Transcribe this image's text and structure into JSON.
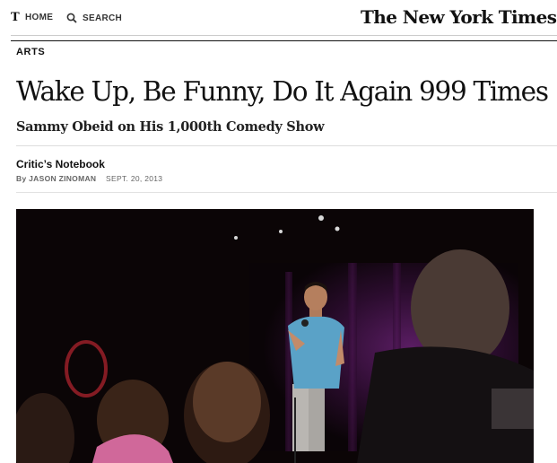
{
  "nav": {
    "home_label": "HOME",
    "search_label": "SEARCH",
    "t_logo": "T"
  },
  "masthead": "The New York Times",
  "section": "ARTS",
  "article": {
    "headline": "Wake Up, Be Funny, Do It Again 999 Times",
    "subheadline": "Sammy Obeid on His 1,000th Comedy Show",
    "kicker": "Critic’s Notebook",
    "byline_prefix": "By",
    "author": "JASON ZINOMAN",
    "date": "SEPT. 20, 2013"
  },
  "photo": {
    "subject": "comedian-on-stage",
    "background_color": "#3a0f3e"
  },
  "colors": {
    "text": "#111111",
    "byline_gray": "#666666",
    "rule": "#cccccc"
  }
}
